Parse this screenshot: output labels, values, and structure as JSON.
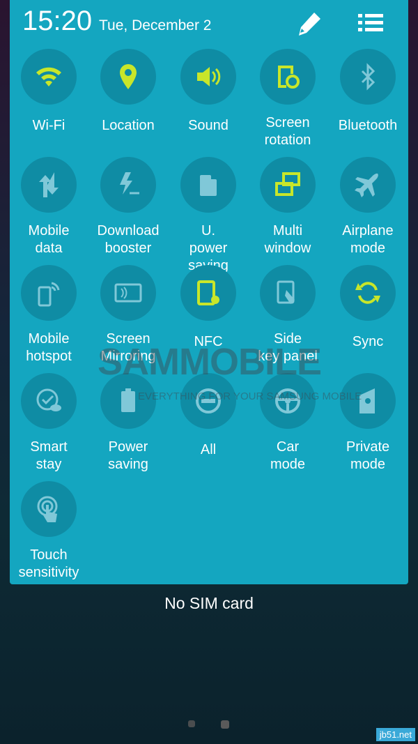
{
  "header": {
    "time": "15:20",
    "date": "Tue, December 2"
  },
  "colors": {
    "panel": "#14a6c0",
    "circle": "#0f8ca4",
    "active": "#c8e62a",
    "inactive": "#80c8d8"
  },
  "tiles": [
    {
      "label": "Wi-Fi",
      "icon": "wifi-icon",
      "active": true
    },
    {
      "label": "Location",
      "icon": "location-icon",
      "active": true
    },
    {
      "label": "Sound",
      "icon": "sound-icon",
      "active": true
    },
    {
      "label": "Screen rotation",
      "icon": "screen-rotation-icon",
      "active": true
    },
    {
      "label": "Bluetooth",
      "icon": "bluetooth-icon",
      "active": false
    },
    {
      "label": "Mobile data",
      "icon": "mobile-data-icon",
      "active": false
    },
    {
      "label": "Download booster",
      "icon": "download-booster-icon",
      "active": false
    },
    {
      "label": "U. power saving",
      "icon": "ultra-power-saving-icon",
      "active": false
    },
    {
      "label": "Multi window",
      "icon": "multi-window-icon",
      "active": true
    },
    {
      "label": "Airplane mode",
      "icon": "airplane-icon",
      "active": false
    },
    {
      "label": "Mobile hotspot",
      "icon": "mobile-hotspot-icon",
      "active": false
    },
    {
      "label": "Screen Mirroring",
      "icon": "screen-mirroring-icon",
      "active": false
    },
    {
      "label": "NFC",
      "icon": "nfc-icon",
      "active": true
    },
    {
      "label": "Side key panel",
      "icon": "side-key-panel-icon",
      "active": false
    },
    {
      "label": "Sync",
      "icon": "sync-icon",
      "active": true
    },
    {
      "label": "Smart stay",
      "icon": "smart-stay-icon",
      "active": false
    },
    {
      "label": "Power saving",
      "icon": "power-saving-icon",
      "active": false
    },
    {
      "label": "All",
      "icon": "all-icon",
      "active": false
    },
    {
      "label": "Car mode",
      "icon": "car-mode-icon",
      "active": false
    },
    {
      "label": "Private mode",
      "icon": "private-mode-icon",
      "active": false
    },
    {
      "label": "Touch sensitivity",
      "icon": "touch-sensitivity-icon",
      "active": false
    }
  ],
  "lockscreen": {
    "status": "No SIM card"
  },
  "watermark": {
    "brand": "SAMMOBILE",
    "tagline": "EVERYTHING FOR YOUR SAMSUNG MOBILE",
    "site": "jb51.net"
  }
}
